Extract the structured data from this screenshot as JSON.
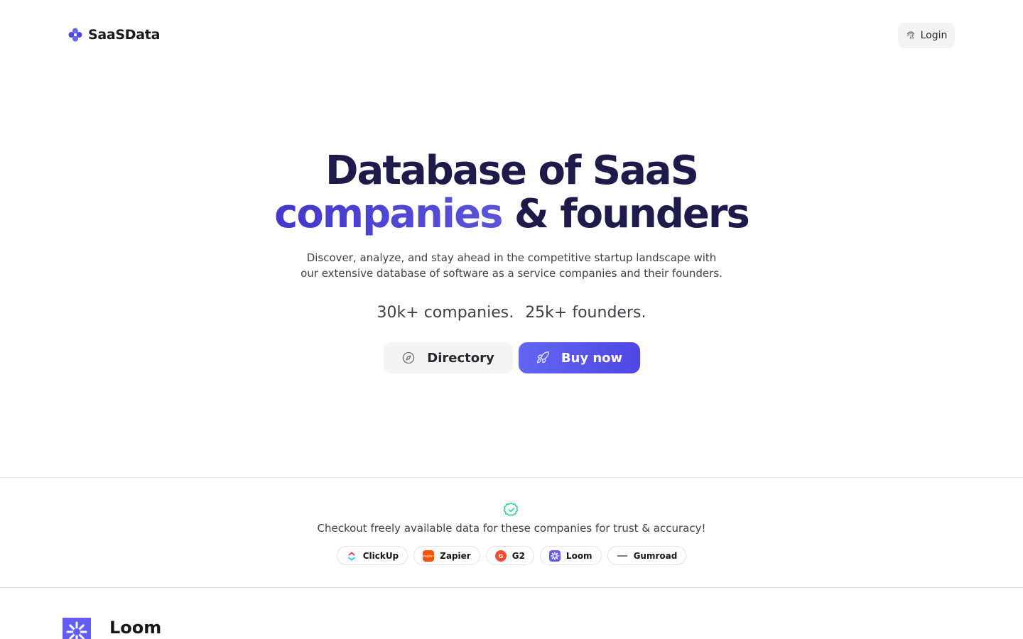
{
  "nav": {
    "brand_name": "SaaSData",
    "login_label": "Login"
  },
  "hero": {
    "title_line1": "Database of SaaS",
    "title_accent": "companies",
    "title_rest": " & founders",
    "subtitle_line1": "Discover, analyze, and stay ahead in the competitive startup landscape with",
    "subtitle_line2": "our extensive database of software as a service companies and their founders.",
    "stat_companies": "30k+ companies.",
    "stat_founders": "25k+ founders."
  },
  "cta": {
    "directory_label": "Directory",
    "buy_label": "Buy now"
  },
  "trust": {
    "text": "Checkout freely available data for these companies for trust & accuracy!",
    "companies": [
      {
        "name": "ClickUp",
        "icon": "clickup-logo"
      },
      {
        "name": "Zapier",
        "icon": "zapier-logo"
      },
      {
        "name": "G2",
        "icon": "g2-logo"
      },
      {
        "name": "Loom",
        "icon": "loom-logo"
      },
      {
        "name": "Gumroad",
        "icon": "gumroad-logo"
      }
    ]
  },
  "preview": {
    "company_name": "Loom"
  },
  "colors": {
    "brand": "#4f46e5",
    "heading": "#1e1b4b",
    "success": "#10b981"
  }
}
